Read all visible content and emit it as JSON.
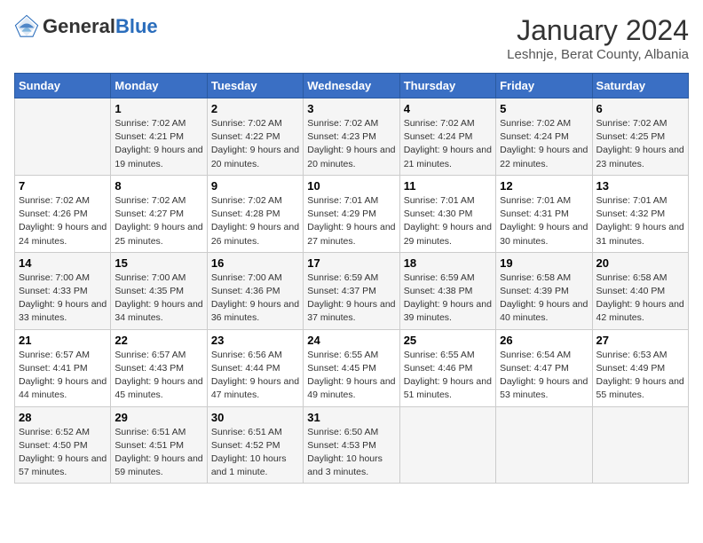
{
  "header": {
    "logo_general": "General",
    "logo_blue": "Blue",
    "month_year": "January 2024",
    "location": "Leshnje, Berat County, Albania"
  },
  "weekdays": [
    "Sunday",
    "Monday",
    "Tuesday",
    "Wednesday",
    "Thursday",
    "Friday",
    "Saturday"
  ],
  "weeks": [
    [
      {
        "day": "",
        "sunrise": "",
        "sunset": "",
        "daylight": ""
      },
      {
        "day": "1",
        "sunrise": "Sunrise: 7:02 AM",
        "sunset": "Sunset: 4:21 PM",
        "daylight": "Daylight: 9 hours and 19 minutes."
      },
      {
        "day": "2",
        "sunrise": "Sunrise: 7:02 AM",
        "sunset": "Sunset: 4:22 PM",
        "daylight": "Daylight: 9 hours and 20 minutes."
      },
      {
        "day": "3",
        "sunrise": "Sunrise: 7:02 AM",
        "sunset": "Sunset: 4:23 PM",
        "daylight": "Daylight: 9 hours and 20 minutes."
      },
      {
        "day": "4",
        "sunrise": "Sunrise: 7:02 AM",
        "sunset": "Sunset: 4:24 PM",
        "daylight": "Daylight: 9 hours and 21 minutes."
      },
      {
        "day": "5",
        "sunrise": "Sunrise: 7:02 AM",
        "sunset": "Sunset: 4:24 PM",
        "daylight": "Daylight: 9 hours and 22 minutes."
      },
      {
        "day": "6",
        "sunrise": "Sunrise: 7:02 AM",
        "sunset": "Sunset: 4:25 PM",
        "daylight": "Daylight: 9 hours and 23 minutes."
      }
    ],
    [
      {
        "day": "7",
        "sunrise": "Sunrise: 7:02 AM",
        "sunset": "Sunset: 4:26 PM",
        "daylight": "Daylight: 9 hours and 24 minutes."
      },
      {
        "day": "8",
        "sunrise": "Sunrise: 7:02 AM",
        "sunset": "Sunset: 4:27 PM",
        "daylight": "Daylight: 9 hours and 25 minutes."
      },
      {
        "day": "9",
        "sunrise": "Sunrise: 7:02 AM",
        "sunset": "Sunset: 4:28 PM",
        "daylight": "Daylight: 9 hours and 26 minutes."
      },
      {
        "day": "10",
        "sunrise": "Sunrise: 7:01 AM",
        "sunset": "Sunset: 4:29 PM",
        "daylight": "Daylight: 9 hours and 27 minutes."
      },
      {
        "day": "11",
        "sunrise": "Sunrise: 7:01 AM",
        "sunset": "Sunset: 4:30 PM",
        "daylight": "Daylight: 9 hours and 29 minutes."
      },
      {
        "day": "12",
        "sunrise": "Sunrise: 7:01 AM",
        "sunset": "Sunset: 4:31 PM",
        "daylight": "Daylight: 9 hours and 30 minutes."
      },
      {
        "day": "13",
        "sunrise": "Sunrise: 7:01 AM",
        "sunset": "Sunset: 4:32 PM",
        "daylight": "Daylight: 9 hours and 31 minutes."
      }
    ],
    [
      {
        "day": "14",
        "sunrise": "Sunrise: 7:00 AM",
        "sunset": "Sunset: 4:33 PM",
        "daylight": "Daylight: 9 hours and 33 minutes."
      },
      {
        "day": "15",
        "sunrise": "Sunrise: 7:00 AM",
        "sunset": "Sunset: 4:35 PM",
        "daylight": "Daylight: 9 hours and 34 minutes."
      },
      {
        "day": "16",
        "sunrise": "Sunrise: 7:00 AM",
        "sunset": "Sunset: 4:36 PM",
        "daylight": "Daylight: 9 hours and 36 minutes."
      },
      {
        "day": "17",
        "sunrise": "Sunrise: 6:59 AM",
        "sunset": "Sunset: 4:37 PM",
        "daylight": "Daylight: 9 hours and 37 minutes."
      },
      {
        "day": "18",
        "sunrise": "Sunrise: 6:59 AM",
        "sunset": "Sunset: 4:38 PM",
        "daylight": "Daylight: 9 hours and 39 minutes."
      },
      {
        "day": "19",
        "sunrise": "Sunrise: 6:58 AM",
        "sunset": "Sunset: 4:39 PM",
        "daylight": "Daylight: 9 hours and 40 minutes."
      },
      {
        "day": "20",
        "sunrise": "Sunrise: 6:58 AM",
        "sunset": "Sunset: 4:40 PM",
        "daylight": "Daylight: 9 hours and 42 minutes."
      }
    ],
    [
      {
        "day": "21",
        "sunrise": "Sunrise: 6:57 AM",
        "sunset": "Sunset: 4:41 PM",
        "daylight": "Daylight: 9 hours and 44 minutes."
      },
      {
        "day": "22",
        "sunrise": "Sunrise: 6:57 AM",
        "sunset": "Sunset: 4:43 PM",
        "daylight": "Daylight: 9 hours and 45 minutes."
      },
      {
        "day": "23",
        "sunrise": "Sunrise: 6:56 AM",
        "sunset": "Sunset: 4:44 PM",
        "daylight": "Daylight: 9 hours and 47 minutes."
      },
      {
        "day": "24",
        "sunrise": "Sunrise: 6:55 AM",
        "sunset": "Sunset: 4:45 PM",
        "daylight": "Daylight: 9 hours and 49 minutes."
      },
      {
        "day": "25",
        "sunrise": "Sunrise: 6:55 AM",
        "sunset": "Sunset: 4:46 PM",
        "daylight": "Daylight: 9 hours and 51 minutes."
      },
      {
        "day": "26",
        "sunrise": "Sunrise: 6:54 AM",
        "sunset": "Sunset: 4:47 PM",
        "daylight": "Daylight: 9 hours and 53 minutes."
      },
      {
        "day": "27",
        "sunrise": "Sunrise: 6:53 AM",
        "sunset": "Sunset: 4:49 PM",
        "daylight": "Daylight: 9 hours and 55 minutes."
      }
    ],
    [
      {
        "day": "28",
        "sunrise": "Sunrise: 6:52 AM",
        "sunset": "Sunset: 4:50 PM",
        "daylight": "Daylight: 9 hours and 57 minutes."
      },
      {
        "day": "29",
        "sunrise": "Sunrise: 6:51 AM",
        "sunset": "Sunset: 4:51 PM",
        "daylight": "Daylight: 9 hours and 59 minutes."
      },
      {
        "day": "30",
        "sunrise": "Sunrise: 6:51 AM",
        "sunset": "Sunset: 4:52 PM",
        "daylight": "Daylight: 10 hours and 1 minute."
      },
      {
        "day": "31",
        "sunrise": "Sunrise: 6:50 AM",
        "sunset": "Sunset: 4:53 PM",
        "daylight": "Daylight: 10 hours and 3 minutes."
      },
      {
        "day": "",
        "sunrise": "",
        "sunset": "",
        "daylight": ""
      },
      {
        "day": "",
        "sunrise": "",
        "sunset": "",
        "daylight": ""
      },
      {
        "day": "",
        "sunrise": "",
        "sunset": "",
        "daylight": ""
      }
    ]
  ]
}
